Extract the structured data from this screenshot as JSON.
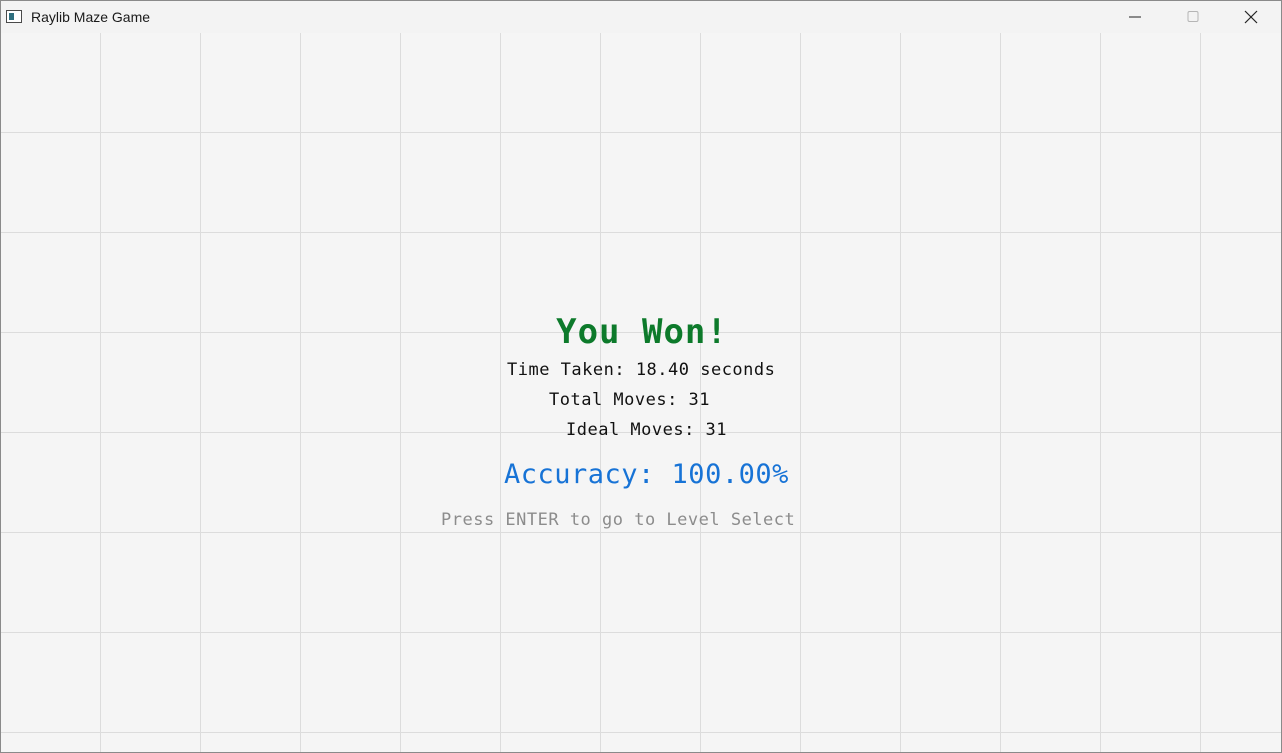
{
  "window": {
    "title": "Raylib Maze Game",
    "controls": [
      "minimize",
      "maximize",
      "close"
    ]
  },
  "game_over": {
    "title": "You Won!",
    "time_taken": "Time Taken: 18.40 seconds",
    "total_moves": "Total Moves: 31",
    "ideal_moves": "Ideal Moves: 31",
    "accuracy": "Accuracy: 100.00%",
    "hint": "Press ENTER to go to Level Select"
  },
  "colors": {
    "win_title": "#0d7a2b",
    "accuracy": "#1773d6",
    "hint": "#8c8c8c",
    "grid": "#dcdcdc",
    "background": "#f5f5f5"
  }
}
